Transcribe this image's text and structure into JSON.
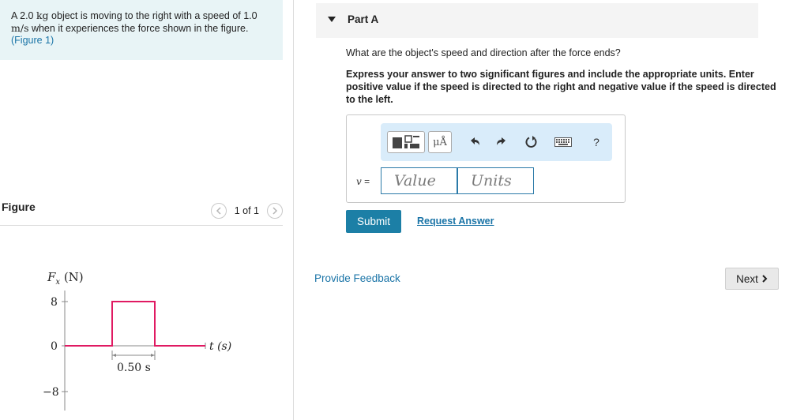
{
  "problem": {
    "text_before": "A 2.0 ",
    "unit_kg": "kg",
    "text_mid": " object is moving to the right with a speed of 1.0 ",
    "unit_speed": "m/s",
    "text_after": " when it experiences the force shown in the figure. ",
    "figure_link": "(Figure 1)"
  },
  "figure": {
    "title": "Figure",
    "pager_text": "1 of 1",
    "prev_icon": "chevron-left-icon",
    "next_icon": "chevron-right-icon",
    "graph": {
      "y_axis_label": "F",
      "y_axis_sub": "x",
      "y_axis_unit": " (N)",
      "x_axis_label": "t (s)",
      "y_ticks": [
        "8",
        "0",
        "−8"
      ],
      "duration_label": "0.50 s",
      "pulse_color": "#e01a62",
      "pulse_force": 8,
      "pulse_duration": 0.5
    }
  },
  "part": {
    "label": "Part A",
    "question": "What are the object's speed and direction after the force ends?",
    "instructions": "Express your answer to two significant figures and include the appropriate units. Enter positive value if the speed is directed to the right and negative value if the speed is directed to the left.",
    "toolbar": {
      "units_button": "μÅ",
      "help": "?",
      "icons": [
        "templates-icon",
        "units-icon",
        "undo-icon",
        "redo-icon",
        "reset-icon",
        "keyboard-icon",
        "help-icon"
      ]
    },
    "variable": "v",
    "equals": " =",
    "value_placeholder": "Value",
    "units_placeholder": "Units",
    "submit_label": "Submit",
    "request_answer_label": "Request Answer"
  },
  "footer": {
    "feedback_label": "Provide Feedback",
    "next_label": "Next"
  },
  "colors": {
    "accent": "#1c7fa6",
    "link": "#1a74a7",
    "problem_bg": "#e8f4f6",
    "toolbar_bg": "#d9ecfa"
  }
}
